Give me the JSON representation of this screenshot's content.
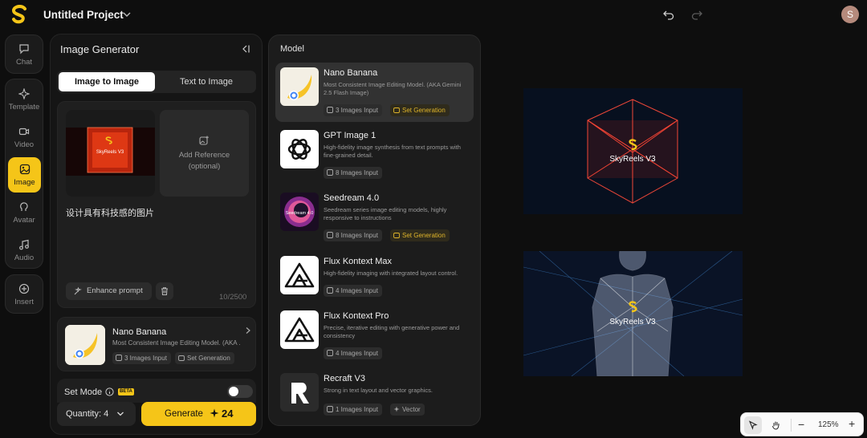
{
  "topbar": {
    "project_title": "Untitled Project",
    "user_initial": "S"
  },
  "rail": {
    "chat": "Chat",
    "template": "Template",
    "video": "Video",
    "image": "Image",
    "avatar": "Avatar",
    "audio": "Audio",
    "insert": "Insert",
    "active": "Image"
  },
  "generator": {
    "title": "Image Generator",
    "tabs": [
      {
        "label": "Image to Image",
        "active": true
      },
      {
        "label": "Text to Image",
        "active": false
      }
    ],
    "ref_thumb_text": "SkyReels V3",
    "add_reference": "Add Reference",
    "add_reference_note": "(optional)",
    "prompt": "设计具有科技感的图片",
    "enhance_label": "Enhance prompt",
    "char_count": "10/2500",
    "selected_model": {
      "name": "Nano Banana",
      "desc": "Most Consistent Image Editing Model. (AKA ...",
      "chip_inputs": "3 Images Input",
      "chip_set": "Set Generation"
    },
    "set_mode_label": "Set Mode",
    "beta_badge": "BETA",
    "set_mode_enabled": false,
    "quantity_label": "Quantity: 4",
    "generate_label": "Generate",
    "generate_cost": "24"
  },
  "model_panel": {
    "title": "Model",
    "models": [
      {
        "name": "Nano Banana",
        "desc": "Most Consistent Image Editing Model. (AKA Gemini 2.5 Flash Image)",
        "chips": [
          "3 Images Input",
          "Set Generation"
        ],
        "selected": true
      },
      {
        "name": "GPT Image 1",
        "desc": "High-fidelity image synthesis from text prompts with fine-grained detail.",
        "chips": [
          "8 Images Input"
        ]
      },
      {
        "name": "Seedream 4.0",
        "desc": "Seedream series image editing models, highly responsive to instructions",
        "chips": [
          "8 Images Input",
          "Set Generation"
        ],
        "icon_text": "Seedream 4.0"
      },
      {
        "name": "Flux Kontext Max",
        "desc": "High-fidelity imaging with integrated layout control.",
        "chips": [
          "4 Images Input"
        ]
      },
      {
        "name": "Flux Kontext Pro",
        "desc": "Precise, iterative editing with generative power and consistency",
        "chips": [
          "4 Images Input"
        ]
      },
      {
        "name": "Recraft V3",
        "desc": "Strong in text layout and vector graphics.",
        "chips": [
          "1 Images Input",
          "Vector"
        ]
      }
    ]
  },
  "canvas": {
    "image1_caption": "SkyReels V3",
    "image2_caption": "SkyReels V3",
    "zoom": "125%"
  },
  "colors": {
    "accent": "#f5c518",
    "background": "#0e0e0e",
    "panel": "#151515"
  }
}
